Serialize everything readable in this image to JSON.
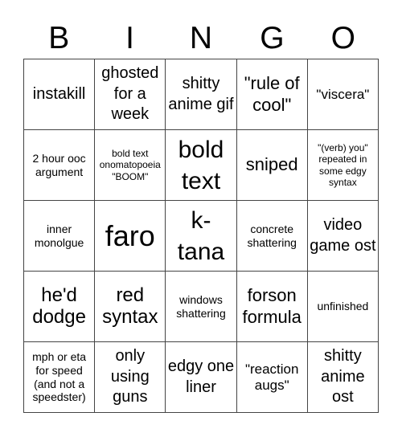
{
  "header": [
    "B",
    "I",
    "N",
    "G",
    "O"
  ],
  "cells": [
    [
      "instakill",
      "ghosted for a week",
      "shitty anime gif",
      "\"rule of cool\"",
      "\"viscera\""
    ],
    [
      "2 hour ooc argument",
      "bold text onomatopoeia \"BOOM\"",
      "bold text",
      "sniped",
      "\"(verb) you\" repeated in some edgy syntax"
    ],
    [
      "inner monolgue",
      "faro",
      "k-tana",
      "concrete shattering",
      "video game ost"
    ],
    [
      "he'd dodge",
      "red syntax",
      "windows shattering",
      "forson formula",
      "unfinished"
    ],
    [
      "mph or eta for speed (and not a speedster)",
      "only using guns",
      "edgy one liner",
      "\"reaction augs\"",
      "shitty anime ost"
    ]
  ]
}
